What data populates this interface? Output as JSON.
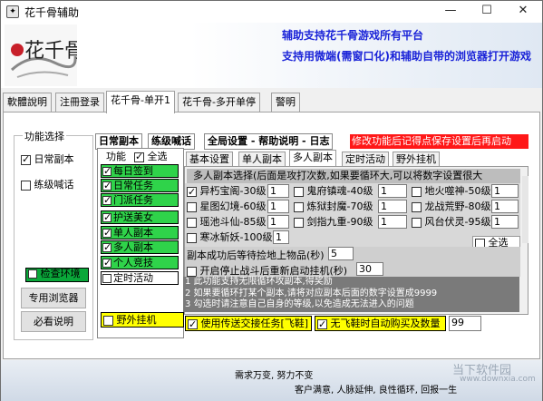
{
  "window": {
    "title": "花千骨辅助",
    "controls": {
      "minimize": "—",
      "maximize": "☐",
      "close": "✕"
    }
  },
  "banner": {
    "line1": "辅助支持花千骨游戏所有平台",
    "line2": "支持用微端(需窗口化)和辅助自带的浏览器打开游戏",
    "logo_text": "花千骨"
  },
  "main_tabs": [
    "軟體說明",
    "注冊登录",
    "花千骨-单开1",
    "花千骨-多开单停",
    "警明"
  ],
  "func_group": {
    "title": "功能选择",
    "daily_label": "日常副本",
    "practice_label": "练级喊话",
    "check_env": "检查环境",
    "browser_btn": "专用浏览器",
    "must_read_btn": "必看说明"
  },
  "inner_tabs": [
    "日常副本",
    "练级喊话",
    "全局设置 - 帮助说明 - 日志"
  ],
  "red_notice": "修改功能后记得点保存设置后再启动",
  "func_header": {
    "label": "功能",
    "select_all": "全选"
  },
  "func_list": [
    {
      "label": "每日签到",
      "checked": true
    },
    {
      "label": "日常任务",
      "checked": true
    },
    {
      "label": "门派任务",
      "checked": true
    },
    {
      "label": "护送美女",
      "checked": true
    },
    {
      "label": "单人副本",
      "checked": true
    },
    {
      "label": "多人副本",
      "checked": true
    },
    {
      "label": "个人竞技",
      "checked": true
    },
    {
      "label": "定时活动",
      "checked": false
    }
  ],
  "wild_hangup": "野外挂机",
  "sub_tabs": [
    "基本设置",
    "单人副本",
    "多人副本",
    "定时活动",
    "野外挂机"
  ],
  "multi": {
    "header": "多人副本选择(后面是攻打次数,如果要循环大,可以将数字设置很大",
    "dungeons": [
      {
        "name": "异朽宝阁",
        "level": "-30级",
        "count": "1",
        "checked": true
      },
      {
        "name": "鬼府镇魂",
        "level": "-40级",
        "count": "1",
        "checked": false
      },
      {
        "name": "地火噬神",
        "level": "-50级",
        "count": "1",
        "checked": false
      },
      {
        "name": "星图幻境",
        "level": "-60级",
        "count": "1",
        "checked": false
      },
      {
        "name": "炼狱封魔",
        "level": "-70级",
        "count": "1",
        "checked": false
      },
      {
        "name": "龙战荒野",
        "level": "-80级",
        "count": "1",
        "checked": false
      },
      {
        "name": "瑶池斗仙",
        "level": "-85级",
        "count": "1",
        "checked": false
      },
      {
        "name": "剑指九重",
        "level": "-90级",
        "count": "1",
        "checked": false
      },
      {
        "name": "风台伏灵",
        "level": "-95级",
        "count": "1",
        "checked": false
      },
      {
        "name": "寒冰斩妖",
        "level": "-100级",
        "count": "1",
        "checked": false
      }
    ],
    "select_all": "全选",
    "wait_label": "副本成功后等待捡地上物品(秒)",
    "wait_value": "5",
    "restart_label": "开启停止战斗后重新启动挂机(秒)",
    "restart_value": "30",
    "notes": [
      "1 此功能支持无限循环攻副本,得奖励",
      "2 如果要循环打某个副本,请将对应副本后面的数字设置成9999",
      "3 勾选时请注意自己自身的等级,以免造成无法进入的问题"
    ]
  },
  "bottom": {
    "teleport_label": "使用传送交接任务[飞鞋]",
    "auto_buy_label": "无飞鞋时自动购买及数量",
    "auto_buy_value": "99"
  },
  "footer": {
    "slogan1": "需求万变, 努力不变",
    "slogan2": "客户满意, 人脉延伸, 良性循环, 回报一生",
    "watermark": "当下软件园",
    "watermark_url": "www.downxia.com"
  }
}
